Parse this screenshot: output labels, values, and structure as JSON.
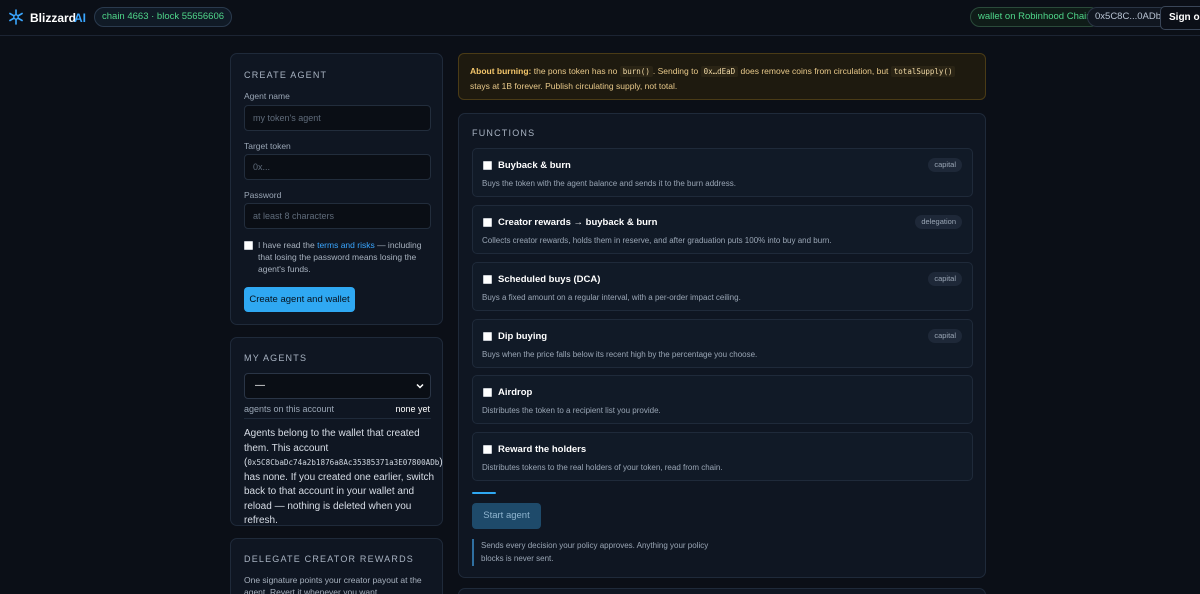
{
  "header": {
    "brand": "Blizzard",
    "brand_suffix": "AI",
    "chain_status": "chain 4663 · block 55656606",
    "wallet_status": "wallet on Robinhood Chain",
    "account_short": "0x5C8C...0ADb",
    "signout_label": "Sign out"
  },
  "create_agent": {
    "title": "CREATE AGENT",
    "name_label": "Agent name",
    "name_placeholder": "my token's agent",
    "token_label": "Target token",
    "token_placeholder": "0x...",
    "password_label": "Password",
    "password_placeholder": "at least 8 characters",
    "terms_prefix": "I have read the ",
    "terms_link": "terms and risks",
    "terms_suffix": " — including that losing the password means losing the agent's funds.",
    "submit_label": "Create agent and wallet"
  },
  "my_agents": {
    "title": "MY AGENTS",
    "selected": "—",
    "count_label": "agents on this account",
    "count_value": "none yet",
    "desc_1": "Agents belong to the wallet that created them. This account (",
    "desc_address": "0x5C8CbaDc74a2b1876a8Ac35385371a3E07800ADb",
    "desc_2": ") has none. If you created one earlier, switch back to that account in your wallet and reload — nothing is deleted when you refresh."
  },
  "delegate": {
    "title": "DELEGATE CREATOR REWARDS",
    "desc": "One signature points your creator payout at the agent. Revert it whenever you want."
  },
  "notice": {
    "heading": "About burning:",
    "t1": " the pons token has no ",
    "c1": "burn()",
    "t2": ". Sending to ",
    "c2": "0x…dEaD",
    "t3": " does remove coins from circulation, but ",
    "c3": "totalSupply()",
    "t4": " stays at 1B forever. Publish circulating supply, not total."
  },
  "functions": {
    "title": "FUNCTIONS",
    "items": [
      {
        "name": "Buyback & burn",
        "desc": "Buys the token with the agent balance and sends it to the burn address.",
        "tag": "capital",
        "checked": false
      },
      {
        "name": "Creator rewards → buyback & burn",
        "desc": "Collects creator rewards, holds them in reserve, and after graduation puts 100% into buy and burn.",
        "tag": "delegation",
        "checked": false
      },
      {
        "name": "Scheduled buys (DCA)",
        "desc": "Buys a fixed amount on a regular interval, with a per-order impact ceiling.",
        "tag": "capital",
        "checked": false
      },
      {
        "name": "Dip buying",
        "desc": "Buys when the price falls below its recent high by the percentage you choose.",
        "tag": "capital",
        "checked": false
      },
      {
        "name": "Airdrop",
        "desc": "Distributes the token to a recipient list you provide.",
        "tag": "",
        "checked": false
      },
      {
        "name": "Reward the holders",
        "desc": "Distributes tokens to the real holders of your token, read from chain.",
        "tag": "",
        "checked": false
      }
    ],
    "start_label": "Start agent",
    "policy_note": "Sends every decision your policy approves. Anything your policy blocks is never sent."
  },
  "colors": {
    "accent": "#2fa8f2",
    "success": "#4fd68a",
    "warning_text": "#f3c66b",
    "background": "#0b0f17"
  }
}
